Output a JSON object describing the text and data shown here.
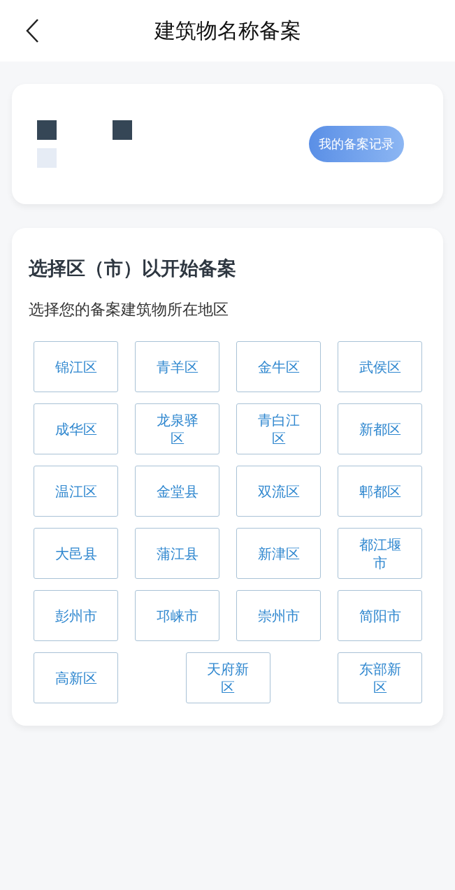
{
  "header": {
    "title": "建筑物名称备案"
  },
  "profile_card": {
    "button": "我的备案记录"
  },
  "region_card": {
    "title": "选择区（市）以开始备案",
    "subtitle": "选择您的备案建筑物所在地区",
    "regions": [
      "锦江区",
      "青羊区",
      "金牛区",
      "武侯区",
      "成华区",
      "龙泉驿区",
      "青白江区",
      "新都区",
      "温江区",
      "金堂县",
      "双流区",
      "郫都区",
      "大邑县",
      "蒲江县",
      "新津区",
      "都江堰市",
      "彭州市",
      "邛崃市",
      "崇州市",
      "简阳市",
      "高新区",
      "天府新区",
      "东部新区"
    ]
  }
}
